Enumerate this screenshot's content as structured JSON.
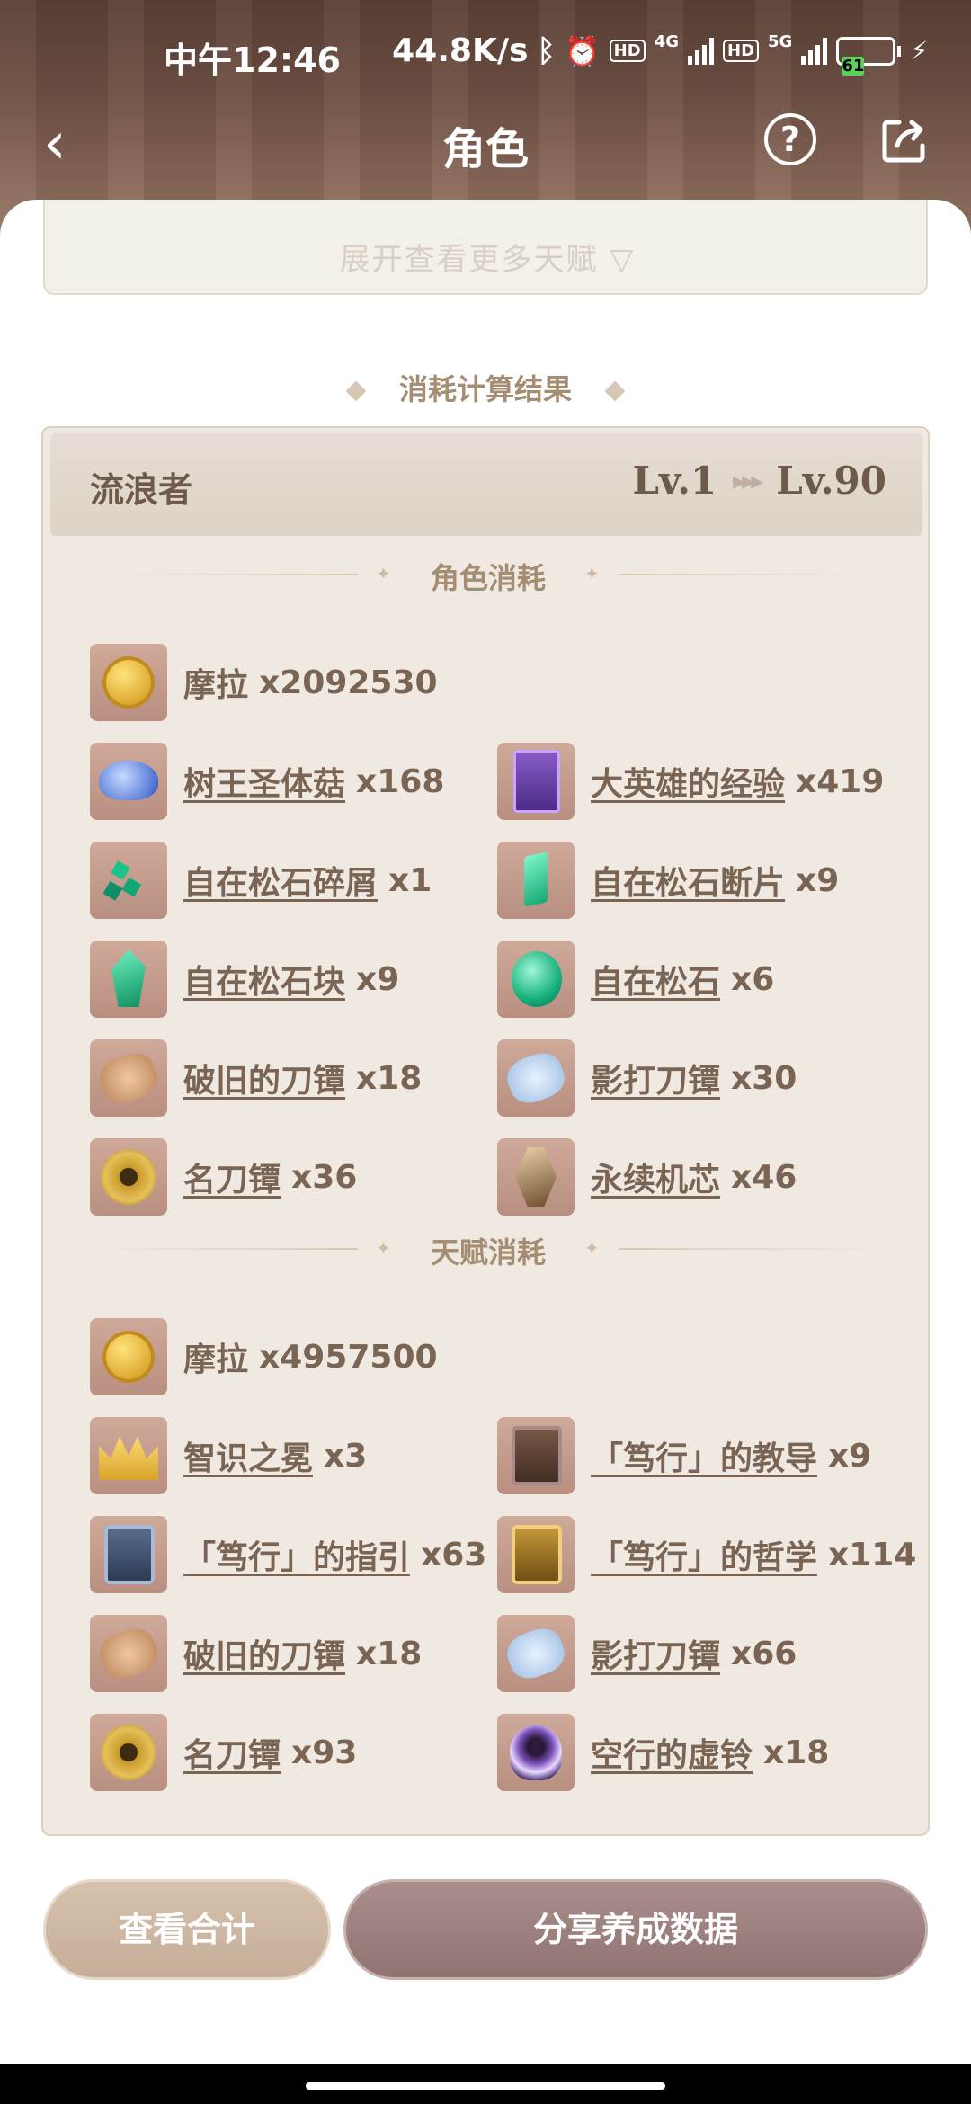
{
  "status": {
    "time": "中午12:46",
    "speed": "44.8K/s",
    "net1": "4G",
    "net2": "5G",
    "hd": "HD",
    "battery": "61"
  },
  "nav": {
    "title": "角色",
    "back_icon": "chevron-left-icon",
    "help": "?",
    "share_icon": "share-icon"
  },
  "expand": {
    "label": "展开查看更多天赋 ▽"
  },
  "result": {
    "heading": "消耗计算结果",
    "character": "流浪者",
    "level_from": "Lv.1",
    "level_to": "Lv.90",
    "arrows": "▸▸▸"
  },
  "character_cost": {
    "label": "角色消耗",
    "mora": {
      "name": "摩拉",
      "qty": "x2092530"
    },
    "items": [
      {
        "name": "树王圣体菇",
        "qty": "x168"
      },
      {
        "name": "大英雄的经验",
        "qty": "x419"
      },
      {
        "name": "自在松石碎屑",
        "qty": "x1"
      },
      {
        "name": "自在松石断片",
        "qty": "x9"
      },
      {
        "name": "自在松石块",
        "qty": "x9"
      },
      {
        "name": "自在松石",
        "qty": "x6"
      },
      {
        "name": "破旧的刀镡",
        "qty": "x18"
      },
      {
        "name": "影打刀镡",
        "qty": "x30"
      },
      {
        "name": "名刀镡",
        "qty": "x36"
      },
      {
        "name": "永续机芯",
        "qty": "x46"
      }
    ]
  },
  "talent_cost": {
    "label": "天赋消耗",
    "mora": {
      "name": "摩拉",
      "qty": "x4957500"
    },
    "items": [
      {
        "name": "智识之冕",
        "qty": "x3"
      },
      {
        "name": "「笃行」的教导",
        "qty": "x9"
      },
      {
        "name": "「笃行」的指引",
        "qty": "x63"
      },
      {
        "name": "「笃行」的哲学",
        "qty": "x114"
      },
      {
        "name": "破旧的刀镡",
        "qty": "x18"
      },
      {
        "name": "影打刀镡",
        "qty": "x66"
      },
      {
        "name": "名刀镡",
        "qty": "x93"
      },
      {
        "name": "空行的虚铃",
        "qty": "x18"
      }
    ]
  },
  "buttons": {
    "total": "查看合计",
    "share": "分享养成数据"
  }
}
